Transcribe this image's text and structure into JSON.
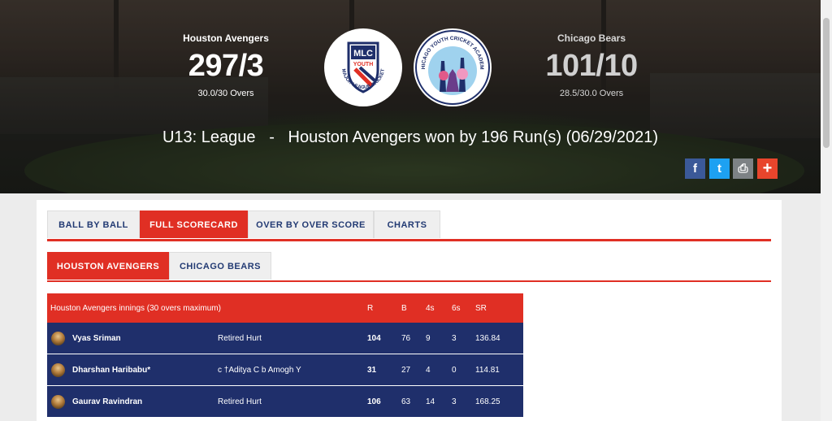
{
  "match": {
    "home": {
      "name": "Houston Avengers",
      "score": "297/3",
      "overs": "30.0/30 Overs"
    },
    "away": {
      "name": "Chicago Bears",
      "score": "101/10",
      "overs": "28.5/30.0 Overs"
    },
    "result": "U13: League   -   Houston Avengers won by 196 Run(s) (06/29/2021)",
    "logo_left": {
      "top": "MLC",
      "mid": "YOUTH",
      "ring": "MAJOR LEAGUE CRICKET"
    },
    "logo_right": {
      "ring": "CHICAGO YOUTH CRICKET ACADEMY"
    }
  },
  "share": {
    "facebook": "f",
    "twitter": "t",
    "print": "⎙",
    "plus": "+"
  },
  "tabs": [
    "BALL BY BALL",
    "FULL SCORECARD",
    "OVER BY OVER SCORE",
    "CHARTS"
  ],
  "team_tabs": [
    "HOUSTON AVENGERS",
    "CHICAGO BEARS"
  ],
  "scorecard": {
    "header": {
      "title": "Houston Avengers innings (30 overs maximum)",
      "r": "R",
      "b": "B",
      "fours": "4s",
      "sixes": "6s",
      "sr": "SR"
    },
    "rows": [
      {
        "name": "Vyas Sriman",
        "dismissal": "Retired Hurt",
        "r": "104",
        "b": "76",
        "fours": "9",
        "sixes": "3",
        "sr": "136.84"
      },
      {
        "name": "Dharshan Haribabu*",
        "dismissal": "c †Aditya C b Amogh Y",
        "r": "31",
        "b": "27",
        "fours": "4",
        "sixes": "0",
        "sr": "114.81"
      },
      {
        "name": "Gaurav Ravindran",
        "dismissal": "Retired Hurt",
        "r": "106",
        "b": "63",
        "fours": "14",
        "sixes": "3",
        "sr": "168.25"
      }
    ]
  },
  "colors": {
    "accent": "#e02f24",
    "navy": "#1f2f6b",
    "tab_text": "#223a73"
  }
}
